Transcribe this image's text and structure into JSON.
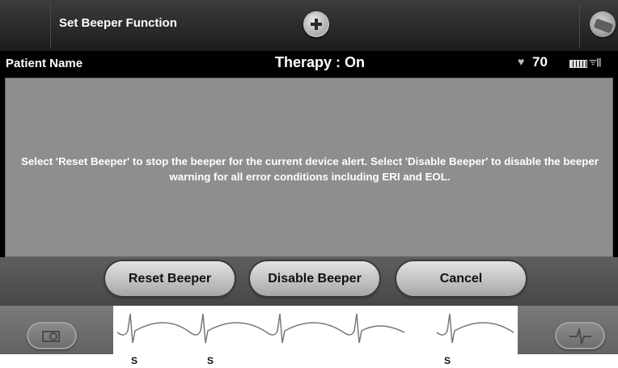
{
  "header": {
    "title": "Set Beeper Function",
    "add_icon": "plus-circle-icon",
    "profile_icon": "user-icon"
  },
  "status": {
    "patient_name": "Patient Name",
    "therapy": "Therapy : On",
    "heart_rate": "70",
    "heart_icon": "heart-icon",
    "battery_icon": "battery-icon",
    "signal_icon": "signal-icon"
  },
  "dialog": {
    "message": "Select 'Reset Beeper' to stop the beeper for the current device alert. Select 'Disable Beeper' to disable the beeper warning for all error conditions including ERI and EOL."
  },
  "buttons": {
    "reset": "Reset Beeper",
    "disable": "Disable Beeper",
    "cancel": "Cancel"
  },
  "ecg": {
    "marker_label": "S",
    "camera_icon": "camera-icon",
    "waveform_icon": "waveform-icon"
  }
}
